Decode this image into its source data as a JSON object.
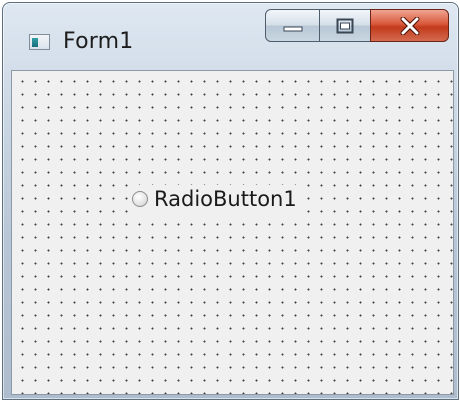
{
  "window": {
    "title": "Form1"
  },
  "controls": {
    "minimize_icon": "minimize-icon",
    "maximize_icon": "maximize-icon",
    "close_icon": "close-icon"
  },
  "form": {
    "radio_button": {
      "label": "RadioButton1",
      "checked": false
    }
  },
  "colors": {
    "close_button": "#c94a2c",
    "titlebar": "#c9d6e3",
    "client_background": "#f0f0f0"
  }
}
